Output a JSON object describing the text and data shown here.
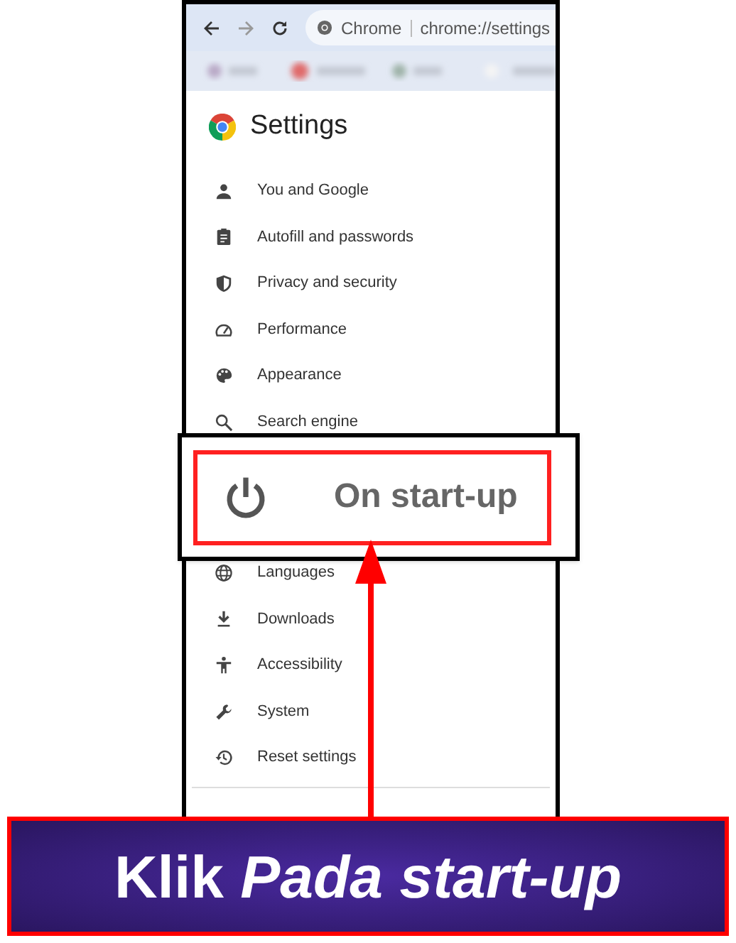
{
  "browser": {
    "site_chip": "Chrome",
    "address": "chrome://settings"
  },
  "settings": {
    "title": "Settings",
    "menu_items": [
      {
        "label": "You and Google",
        "kind": "item"
      },
      {
        "label": "Autofill and passwords",
        "kind": "item"
      },
      {
        "label": "Privacy and security",
        "kind": "item"
      },
      {
        "label": "Performance",
        "kind": "item"
      },
      {
        "label": "Appearance",
        "kind": "item"
      },
      {
        "label": "Search engine",
        "kind": "item"
      },
      {
        "label": "On start-up",
        "kind": "callout"
      },
      {
        "label": "Languages",
        "kind": "item"
      },
      {
        "label": "Downloads",
        "kind": "item"
      },
      {
        "label": "Accessibility",
        "kind": "item"
      },
      {
        "label": "System",
        "kind": "item"
      },
      {
        "label": "Reset settings",
        "kind": "item"
      }
    ]
  },
  "caption": "Klik *Pada start-up*"
}
